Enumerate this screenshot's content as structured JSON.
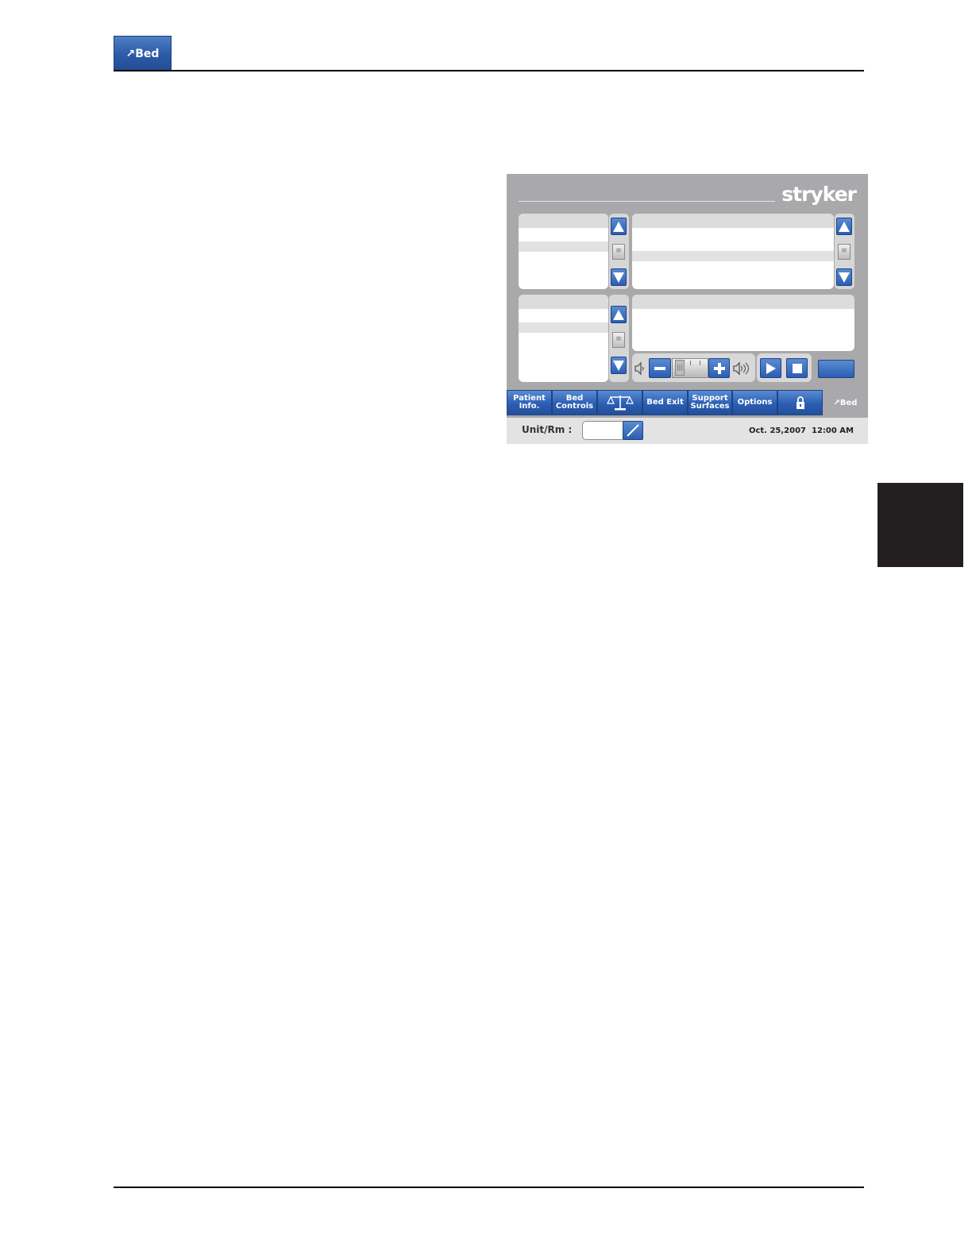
{
  "header": {
    "badge": "↗Bed"
  },
  "screen": {
    "logo": "stryker",
    "volume": {
      "level": 0.1
    },
    "tabs": [
      "Patient Info.",
      "Bed Controls",
      "Bed Exit",
      "Support Surfaces",
      "Options"
    ],
    "tab_brand": "↗Bed",
    "status": {
      "unit_label": "Unit/Rm :",
      "date": "Oct. 25,2007",
      "time": "12:00 AM"
    }
  },
  "icons": {
    "badge_icon": "pen-icon",
    "scale": "scale-icon",
    "lock": "lock-icon",
    "play": "play-icon",
    "stop": "stop-icon",
    "volume_low": "speaker-low-icon",
    "volume_high": "speaker-high-icon"
  },
  "colors": {
    "accent": "#2b5eb4",
    "screen_bg": "#a9a9ab",
    "status_bg": "#e3e3e3"
  }
}
